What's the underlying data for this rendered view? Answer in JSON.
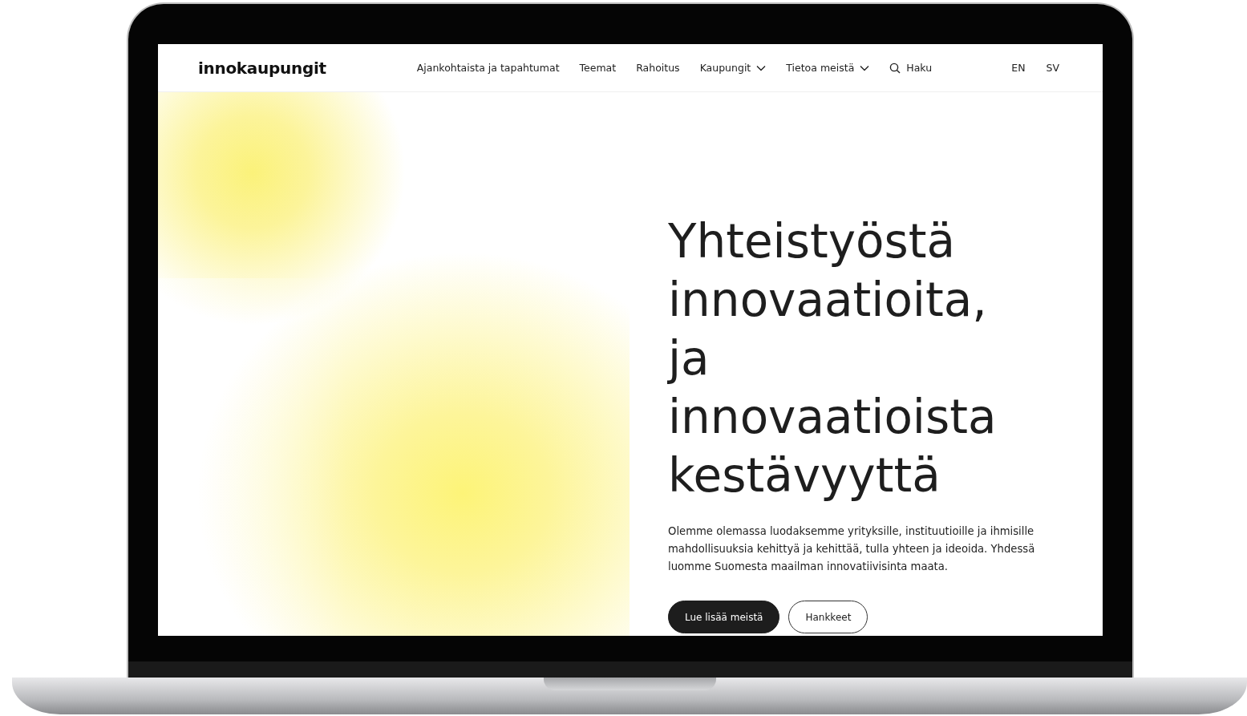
{
  "header": {
    "logo": "innokaupungit",
    "nav": [
      {
        "label": "Ajankohtaista ja tapahtumat",
        "kind": "link"
      },
      {
        "label": "Teemat",
        "kind": "link"
      },
      {
        "label": "Rahoitus",
        "kind": "link"
      },
      {
        "label": "Kaupungit",
        "kind": "dropdown"
      },
      {
        "label": "Tietoa meistä",
        "kind": "dropdown"
      },
      {
        "label": "Haku",
        "kind": "search"
      }
    ],
    "languages": [
      "EN",
      "SV"
    ]
  },
  "hero": {
    "heading": "Yhteistyöstä innovaatioita, ja innovaatioista kestävyyttä",
    "text": "Olemme olemassa luodaksemme yrityksille, instituutioille ja ihmisille mahdollisuuksia kehittyä ja kehittää, tulla yhteen ja ideoida. Yhdessä luomme Suomesta maailman innovatiivisinta maata.",
    "buttons": [
      {
        "label": "Lue lisää meistä",
        "kind": "primary"
      },
      {
        "label": "Hankkeet",
        "kind": "outline"
      }
    ]
  }
}
